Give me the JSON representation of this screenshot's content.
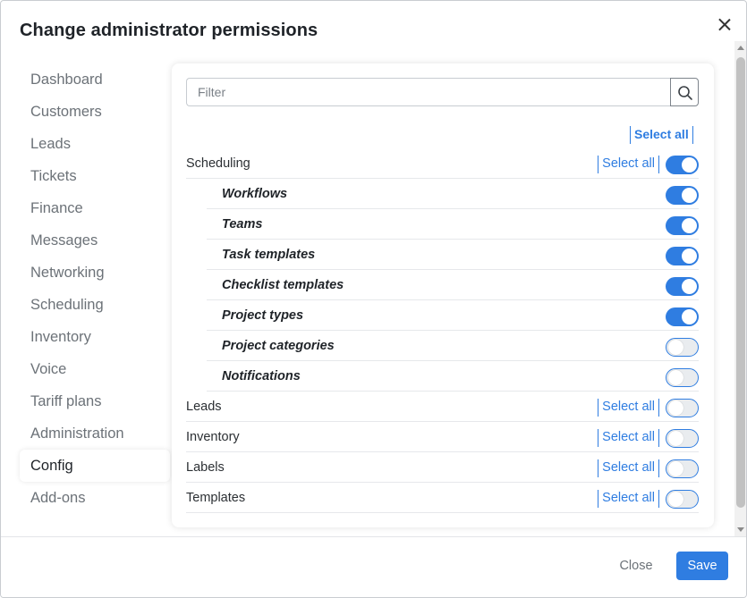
{
  "dialog": {
    "title": "Change administrator permissions",
    "close_icon": "close-icon"
  },
  "sidebar": {
    "items": [
      {
        "label": "Dashboard",
        "active": false
      },
      {
        "label": "Customers",
        "active": false
      },
      {
        "label": "Leads",
        "active": false
      },
      {
        "label": "Tickets",
        "active": false
      },
      {
        "label": "Finance",
        "active": false
      },
      {
        "label": "Messages",
        "active": false
      },
      {
        "label": "Networking",
        "active": false
      },
      {
        "label": "Scheduling",
        "active": false
      },
      {
        "label": "Inventory",
        "active": false
      },
      {
        "label": "Voice",
        "active": false
      },
      {
        "label": "Tariff plans",
        "active": false
      },
      {
        "label": "Administration",
        "active": false
      },
      {
        "label": "Config",
        "active": true
      },
      {
        "label": "Add-ons",
        "active": false
      }
    ]
  },
  "panel": {
    "filter": {
      "placeholder": "Filter",
      "value": "",
      "icon": "search-icon"
    },
    "select_all_top": "Select all",
    "groups": [
      {
        "label": "Scheduling",
        "select_all": "Select all",
        "enabled": true,
        "children": [
          {
            "label": "Workflows",
            "enabled": true
          },
          {
            "label": "Teams",
            "enabled": true
          },
          {
            "label": "Task templates",
            "enabled": true
          },
          {
            "label": "Checklist templates",
            "enabled": true
          },
          {
            "label": "Project types",
            "enabled": true
          },
          {
            "label": "Project categories",
            "enabled": false
          },
          {
            "label": "Notifications",
            "enabled": false
          }
        ]
      },
      {
        "label": "Leads",
        "select_all": "Select all",
        "enabled": false,
        "children": []
      },
      {
        "label": "Inventory",
        "select_all": "Select all",
        "enabled": false,
        "children": []
      },
      {
        "label": "Labels",
        "select_all": "Select all",
        "enabled": false,
        "children": []
      },
      {
        "label": "Templates",
        "select_all": "Select all",
        "enabled": false,
        "children": []
      }
    ]
  },
  "footer": {
    "close_label": "Close",
    "save_label": "Save"
  },
  "colors": {
    "accent": "#2f7de1",
    "toggle_off_bg": "#e9ecef",
    "muted_text": "#6c7278"
  }
}
